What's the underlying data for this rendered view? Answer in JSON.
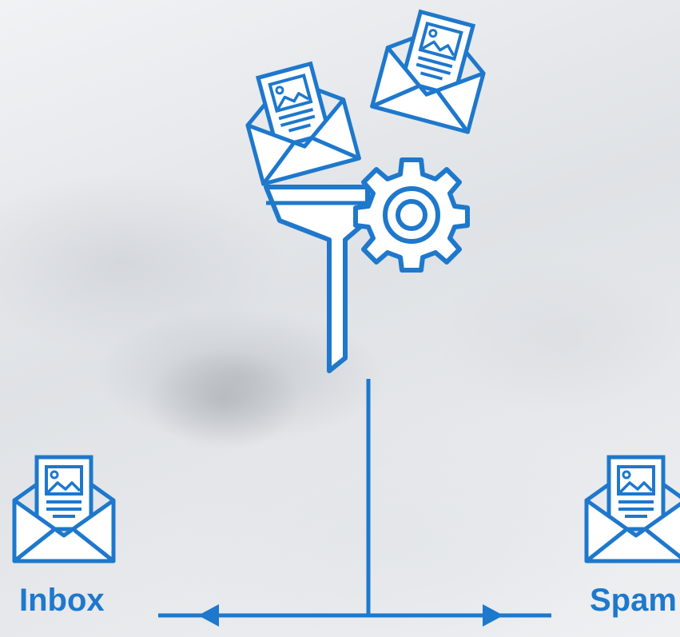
{
  "colors": {
    "accent": "#1e78cc",
    "background": "#e9ebee"
  },
  "icons": {
    "incoming_mail_1": "envelope-with-document-icon",
    "incoming_mail_2": "envelope-with-document-icon",
    "filter": "funnel-with-gear-icon",
    "inbox_mail": "envelope-with-document-icon",
    "spam_mail": "envelope-with-document-icon"
  },
  "labels": {
    "inbox": "Inbox",
    "spam": "Spam"
  }
}
